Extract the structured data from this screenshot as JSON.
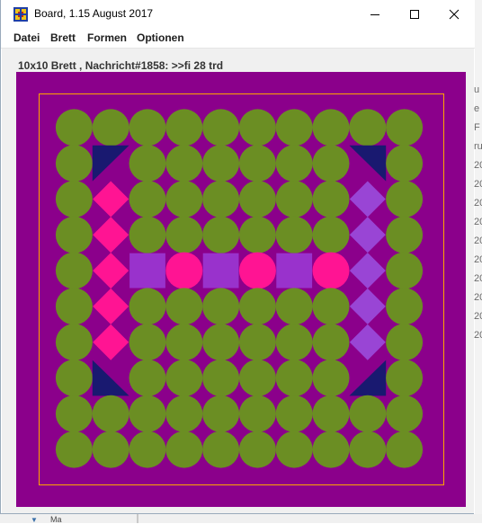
{
  "window": {
    "title": "Board, 1.15 August 2017"
  },
  "menu": {
    "items": [
      "Datei",
      "Brett",
      "Formen",
      "Optionen"
    ]
  },
  "status": {
    "text": "10x10 Brett , Nachricht#1858: >>fi 28 trd"
  },
  "background_app": {
    "right_text": [
      "u",
      "e F",
      "ru",
      "20",
      "20",
      "20",
      "20",
      "20",
      "20",
      "20",
      "20",
      "20",
      "20"
    ],
    "bottom_text": "Ma"
  },
  "board": {
    "rows": 10,
    "cols": 10,
    "colors": {
      "background": "#8B008B",
      "frame": "#FFA500",
      "circle": "#6B8E23",
      "navy": "#191970",
      "pink": "#FF1493",
      "violet": "#9932CC",
      "lavender": "#9945D5"
    },
    "cells": [
      [
        "circle",
        "circle",
        "circle",
        "circle",
        "circle",
        "circle",
        "circle",
        "circle",
        "circle",
        "circle"
      ],
      [
        "circle",
        "triangle-tl",
        "circle",
        "circle",
        "circle",
        "circle",
        "circle",
        "circle",
        "triangle-tr",
        "circle"
      ],
      [
        "circle",
        "diamond-pink",
        "circle",
        "circle",
        "circle",
        "circle",
        "circle",
        "circle",
        "diamond-violet",
        "circle"
      ],
      [
        "circle",
        "diamond-pink",
        "circle",
        "circle",
        "circle",
        "circle",
        "circle",
        "circle",
        "diamond-violet",
        "circle"
      ],
      [
        "circle",
        "diamond-pink",
        "square-violet",
        "circle-pink",
        "square-violet",
        "circle-pink",
        "square-violet",
        "circle-pink",
        "diamond-violet",
        "circle"
      ],
      [
        "circle",
        "diamond-pink",
        "circle",
        "circle",
        "circle",
        "circle",
        "circle",
        "circle",
        "diamond-violet",
        "circle"
      ],
      [
        "circle",
        "diamond-pink",
        "circle",
        "circle",
        "circle",
        "circle",
        "circle",
        "circle",
        "diamond-violet",
        "circle"
      ],
      [
        "circle",
        "triangle-bl",
        "circle",
        "circle",
        "circle",
        "circle",
        "circle",
        "circle",
        "triangle-br",
        "circle"
      ],
      [
        "circle",
        "circle",
        "circle",
        "circle",
        "circle",
        "circle",
        "circle",
        "circle",
        "circle",
        "circle"
      ],
      [
        "circle",
        "circle",
        "circle",
        "circle",
        "circle",
        "circle",
        "circle",
        "circle",
        "circle",
        "circle"
      ]
    ]
  }
}
